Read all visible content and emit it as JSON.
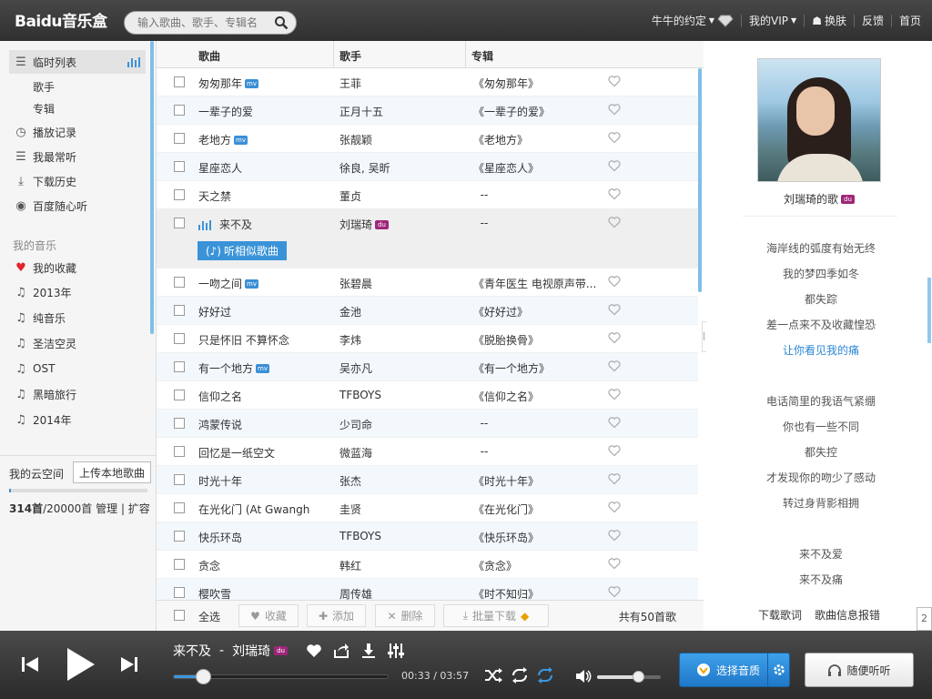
{
  "header": {
    "logo": "Bai⁣du音乐盒",
    "search_placeholder": "输入歌曲、歌手、专辑名",
    "user": "牛牛的约定",
    "vip": "我的VIP",
    "skin": "换肤",
    "feedback": "反馈",
    "home": "首页"
  },
  "sidebar": {
    "temp_list": "临时列表",
    "artist": "歌手",
    "album": "专辑",
    "play_history": "播放记录",
    "most_played": "我最常听",
    "download_history": "下载历史",
    "baidu_radio": "百度随心听",
    "my_music": "我的音乐",
    "favorites": "我的收藏",
    "playlists": [
      "2013年",
      "纯音乐",
      "圣洁空灵",
      "OST",
      "黑暗旅行",
      "2014年"
    ],
    "cloud": "我的云空间",
    "upload": "上传本地歌曲",
    "cloud_count": "314首",
    "cloud_total": "/20000首",
    "manage": "管理",
    "expand": "扩容",
    "cloud_usage": 0.0157
  },
  "list": {
    "headers": {
      "song": "歌曲",
      "artist": "歌手",
      "album": "专辑"
    },
    "rows": [
      {
        "song": "匆匆那年",
        "artist": "王菲",
        "album": "《匆匆那年》",
        "badge": "mv"
      },
      {
        "song": "一辈子的爱",
        "artist": "正月十五",
        "album": "《一辈子的爱》",
        "badge": ""
      },
      {
        "song": "老地方",
        "artist": "张靓颖",
        "album": "《老地方》",
        "badge": "mv"
      },
      {
        "song": "星座恋人",
        "artist": "徐良, 吴昕",
        "album": "《星座恋人》",
        "badge": ""
      },
      {
        "song": "天之禁",
        "artist": "董贞",
        "album": "  --",
        "badge": ""
      },
      {
        "song": "来不及",
        "artist": "刘瑞琦",
        "album": "  --",
        "badge": "",
        "playing": true
      },
      {
        "song": "一吻之间",
        "artist": "张碧晨",
        "album": "《青年医生 电视原声带...",
        "badge": "mv"
      },
      {
        "song": "好好过",
        "artist": "金池",
        "album": "《好好过》",
        "badge": ""
      },
      {
        "song": "只是怀旧 不算怀念",
        "artist": "李炜",
        "album": "《脱胎换骨》",
        "badge": ""
      },
      {
        "song": "有一个地方",
        "artist": "吴亦凡",
        "album": "《有一个地方》",
        "badge": "mv"
      },
      {
        "song": "信仰之名",
        "artist": "TFBOYS",
        "album": "《信仰之名》",
        "badge": ""
      },
      {
        "song": "鸿蒙传说",
        "artist": "少司命",
        "album": "  --",
        "badge": ""
      },
      {
        "song": "回忆是一纸空文",
        "artist": "微蓝海",
        "album": "  --",
        "badge": ""
      },
      {
        "song": "时光十年",
        "artist": "张杰",
        "album": "《时光十年》",
        "badge": ""
      },
      {
        "song": "在光化门 (At Gwangh",
        "artist": "圭贤",
        "album": "《在光化门》",
        "badge": ""
      },
      {
        "song": "快乐环岛",
        "artist": "TFBOYS",
        "album": "《快乐环岛》",
        "badge": ""
      },
      {
        "song": "贪念",
        "artist": "韩红",
        "album": "《贪念》",
        "badge": ""
      },
      {
        "song": "樱吹雪",
        "artist": "周传雄",
        "album": "《时不知归》",
        "badge": ""
      }
    ],
    "similar": "听相似歌曲",
    "footer": {
      "select_all": "全选",
      "collect": "收藏",
      "add": "添加",
      "delete": "删除",
      "batch_download": "批量下载",
      "total": "共有50首歌"
    }
  },
  "right": {
    "artist_song": "刘瑞琦的歌",
    "lyrics": [
      "海岸线的弧度有始无终",
      "我的梦四季如冬",
      "都失踪",
      "差一点来不及收藏惶恐",
      "让你看见我的痛",
      "",
      "电话简里的我语气紧绷",
      "你也有一些不同",
      "都失控",
      "才发现你的吻少了感动",
      "转过身背影相拥",
      "",
      "来不及爱",
      "来不及痛"
    ],
    "current_lyric_index": 4,
    "download_lyrics": "下载歌词",
    "report": "歌曲信息报错",
    "edge1": "2",
    "edge2": "1"
  },
  "player": {
    "song": "来不及",
    "dash": "-",
    "artist": "刘瑞琦",
    "time": "00:33 / 03:57",
    "progress": 0.139,
    "volume": 0.64,
    "quality": "选择音质",
    "radio": "随便听听"
  },
  "colors": {
    "accent": "#3a93d8",
    "du_badge": "#a0267a",
    "heart_red": "#e0252b"
  }
}
